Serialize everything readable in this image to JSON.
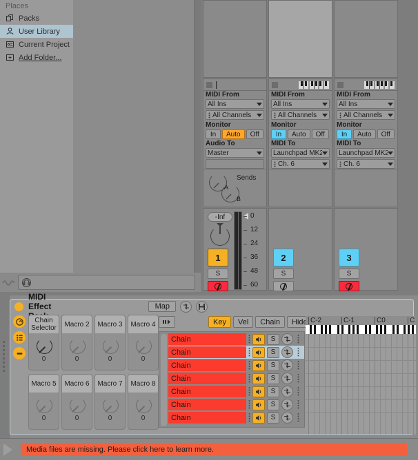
{
  "browser": {
    "header": "Places",
    "items": [
      {
        "label": "Packs",
        "icon": "packs-icon",
        "selected": false,
        "underline": false
      },
      {
        "label": "User Library",
        "icon": "user-library-icon",
        "selected": true,
        "underline": false
      },
      {
        "label": "Current Project",
        "icon": "current-project-icon",
        "selected": false,
        "underline": false
      },
      {
        "label": "Add Folder...",
        "icon": "add-folder-icon",
        "selected": false,
        "underline": true
      }
    ]
  },
  "preview": {
    "headphone_icon": "headphone-icon",
    "waveform_icon": "waveform-icon"
  },
  "session": {
    "tracks": [
      {
        "number": "1",
        "kind": "audio",
        "has_keyboard_icon": false,
        "midi_from_label": "MIDI From",
        "midi_from": "All Ins",
        "midi_channel": "All Channels",
        "monitor_label": "Monitor",
        "monitor": {
          "in": "In",
          "auto": "Auto",
          "off": "Off",
          "active": "Auto"
        },
        "out_label": "Audio To",
        "out_value": "Master",
        "out_channel": "",
        "sends_label": "Sends",
        "send_a": "A",
        "send_b": "B",
        "volume_display": "-Inf",
        "solo_label": "S",
        "has_meter_scale": true,
        "meter_scale": [
          "0",
          "12",
          "24",
          "36",
          "48",
          "60"
        ],
        "color": "#f5b024",
        "arm_active": true
      },
      {
        "number": "2",
        "kind": "midi",
        "has_keyboard_icon": true,
        "midi_from_label": "MIDI From",
        "midi_from": "All Ins",
        "midi_channel": "All Channels",
        "monitor_label": "Monitor",
        "monitor": {
          "in": "In",
          "auto": "Auto",
          "off": "Off",
          "active": "In"
        },
        "out_label": "MIDI To",
        "out_value": "Launchpad MK2 (",
        "out_channel": "Ch. 6",
        "solo_label": "S",
        "has_meter_scale": false,
        "color": "#5fd0f5",
        "arm_active": false
      },
      {
        "number": "3",
        "kind": "midi",
        "has_keyboard_icon": true,
        "midi_from_label": "MIDI From",
        "midi_from": "All Ins",
        "midi_channel": "All Channels",
        "monitor_label": "Monitor",
        "monitor": {
          "in": "In",
          "auto": "Auto",
          "off": "Off",
          "active": "In"
        },
        "out_label": "MIDI To",
        "out_value": "Launchpad MK2 (",
        "out_channel": "Ch. 6",
        "solo_label": "S",
        "has_meter_scale": false,
        "color": "#5fd0f5",
        "arm_active": true
      }
    ]
  },
  "device": {
    "title": "MIDI Effect Rack",
    "power_icon": "power-icon",
    "map_label": "Map",
    "unfold_icon": "chain-unfold-icon",
    "save_icon": "save-preset-icon",
    "side_buttons": [
      {
        "icon": "show-macros-icon"
      },
      {
        "icon": "show-chain-list-icon"
      },
      {
        "icon": "show-devices-icon"
      }
    ],
    "macros": [
      {
        "name": "Chain Selector",
        "value": "0",
        "active": true
      },
      {
        "name": "Macro 2",
        "value": "0",
        "active": false
      },
      {
        "name": "Macro 3",
        "value": "0",
        "active": false
      },
      {
        "name": "Macro 4",
        "value": "0",
        "active": false
      },
      {
        "name": "Macro 5",
        "value": "0",
        "active": false
      },
      {
        "name": "Macro 6",
        "value": "0",
        "active": false
      },
      {
        "name": "Macro 7",
        "value": "0",
        "active": false
      },
      {
        "name": "Macro 8",
        "value": "0",
        "active": false
      }
    ],
    "chain_toolbar": {
      "fold_icon": "fold-chains-icon",
      "zones": [
        {
          "label": "Key",
          "active": true
        },
        {
          "label": "Vel",
          "active": false
        },
        {
          "label": "Chain",
          "active": false
        },
        {
          "label": "Hide",
          "active": false
        }
      ]
    },
    "chains": [
      {
        "name": "Chain",
        "speaker_icon": "speaker-icon",
        "solo_label": "S",
        "hotswap_icon": "hot-swap-icon",
        "selected": false
      },
      {
        "name": "Chain",
        "speaker_icon": "speaker-icon",
        "solo_label": "S",
        "hotswap_icon": "hot-swap-icon",
        "selected": true
      },
      {
        "name": "Chain",
        "speaker_icon": "speaker-icon",
        "solo_label": "S",
        "hotswap_icon": "hot-swap-icon",
        "selected": false
      },
      {
        "name": "Chain",
        "speaker_icon": "speaker-icon",
        "solo_label": "S",
        "hotswap_icon": "hot-swap-icon",
        "selected": false
      },
      {
        "name": "Chain",
        "speaker_icon": "speaker-icon",
        "solo_label": "S",
        "hotswap_icon": "hot-swap-icon",
        "selected": false
      },
      {
        "name": "Chain",
        "speaker_icon": "speaker-icon",
        "solo_label": "S",
        "hotswap_icon": "hot-swap-icon",
        "selected": false
      },
      {
        "name": "Chain",
        "speaker_icon": "speaker-icon",
        "solo_label": "S",
        "hotswap_icon": "hot-swap-icon",
        "selected": false
      }
    ],
    "zone_editor": {
      "ruler_labels": [
        "C-2",
        "C-1",
        "C0",
        "C"
      ]
    }
  },
  "status": {
    "message": "Media files are missing. Please click here to learn more.",
    "play_icon": "play-icon",
    "color": "#f4603e"
  }
}
